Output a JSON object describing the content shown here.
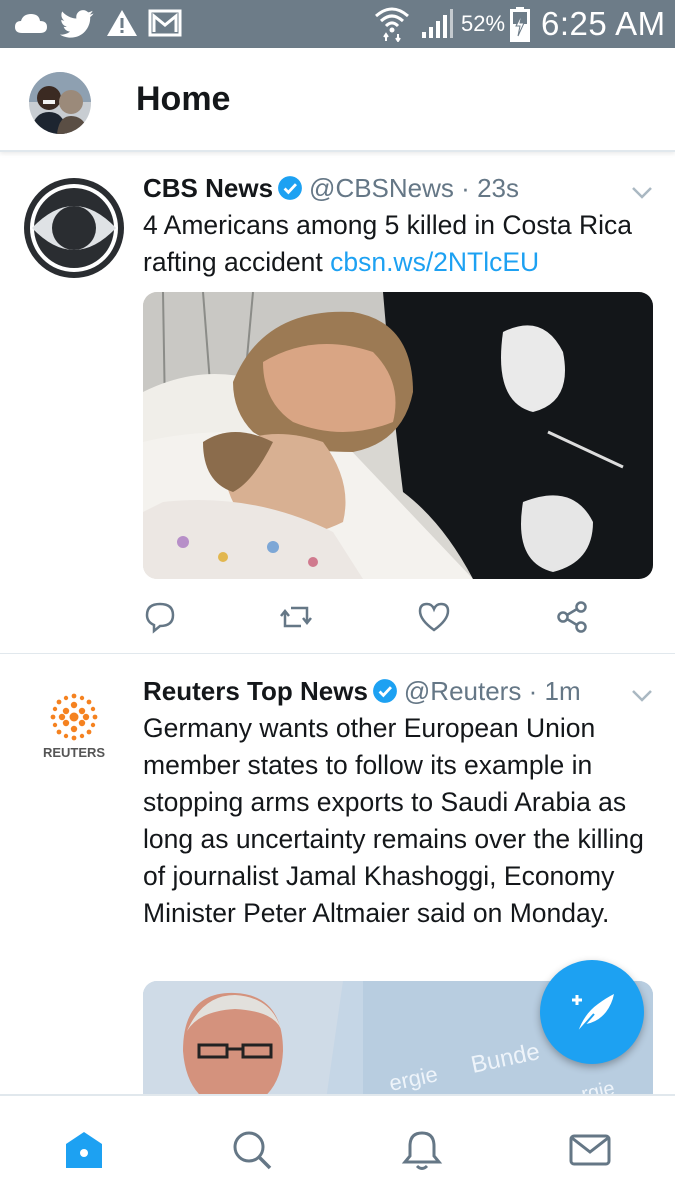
{
  "status_bar": {
    "battery_percent": "52%",
    "time": "6:25 AM",
    "icons": [
      "cloud-icon",
      "twitter-bird-icon",
      "warning-icon",
      "gmail-icon",
      "wifi-icon",
      "signal-icon",
      "battery-charging-icon"
    ]
  },
  "header": {
    "title": "Home",
    "avatar_icon": "profile-avatar"
  },
  "tweets": [
    {
      "name": "CBS News",
      "verified": true,
      "handle": "@CBSNews",
      "separator": "·",
      "time": "23s",
      "text": "4 Americans among 5 killed in Costa Rica rafting accident ",
      "link": "cbsn.ws/2NTlcEU",
      "avatar_icon": "cbs-eye-logo",
      "media_icon": "hospital-photo"
    },
    {
      "name": "Reuters Top News",
      "verified": true,
      "handle": "@Reuters",
      "separator": "·",
      "time": "1m",
      "text": "Germany wants other European Union member states to follow its example in stopping arms exports to Saudi Arabia as long as uncertainty remains over the killing of journalist Jamal Khashoggi, Economy Minister Peter Altmaier said on Monday.",
      "avatar_label": "REUTERS",
      "media_icon": "press-photo",
      "media_sign_text_1": "Bunde",
      "media_sign_text_2": "ergie",
      "media_sign_text_3": "rgie"
    }
  ],
  "tweet_actions": [
    "reply-icon",
    "retweet-icon",
    "like-icon",
    "share-icon"
  ],
  "bottom_nav": [
    "home-icon",
    "search-icon",
    "notifications-icon",
    "messages-icon"
  ],
  "colors": {
    "status_bar_bg": "#6d7c88",
    "accent": "#1da1f2",
    "text_primary": "#14171a",
    "text_secondary": "#657786",
    "divider": "#e1e8ed"
  }
}
